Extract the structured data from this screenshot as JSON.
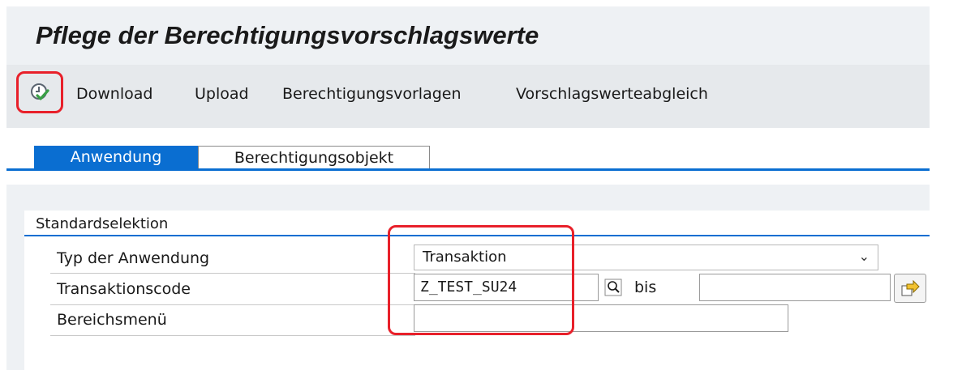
{
  "title": "Pflege der Berechtigungsvorschlagswerte",
  "toolbar": {
    "execute_icon": "execute-clock-check-icon",
    "items": [
      "Download",
      "Upload",
      "Berechtigungsvorlagen",
      "Vorschlagswerteabgleich"
    ]
  },
  "tabs": [
    "Anwendung",
    "Berechtigungsobjekt"
  ],
  "active_tab": "Anwendung",
  "group": {
    "title": "Standardselektion",
    "fields": {
      "typ_label": "Typ der Anwendung",
      "typ_value": "Transaktion",
      "code_label": "Transaktionscode",
      "code_value": "Z_TEST_SU24",
      "bis_label": "bis",
      "code_to_value": "",
      "menu_label": "Bereichsmenü",
      "menu_value": ""
    }
  },
  "colors": {
    "accent": "#0a6ed1",
    "highlight": "#e8202a",
    "background": "#eef1f4"
  }
}
